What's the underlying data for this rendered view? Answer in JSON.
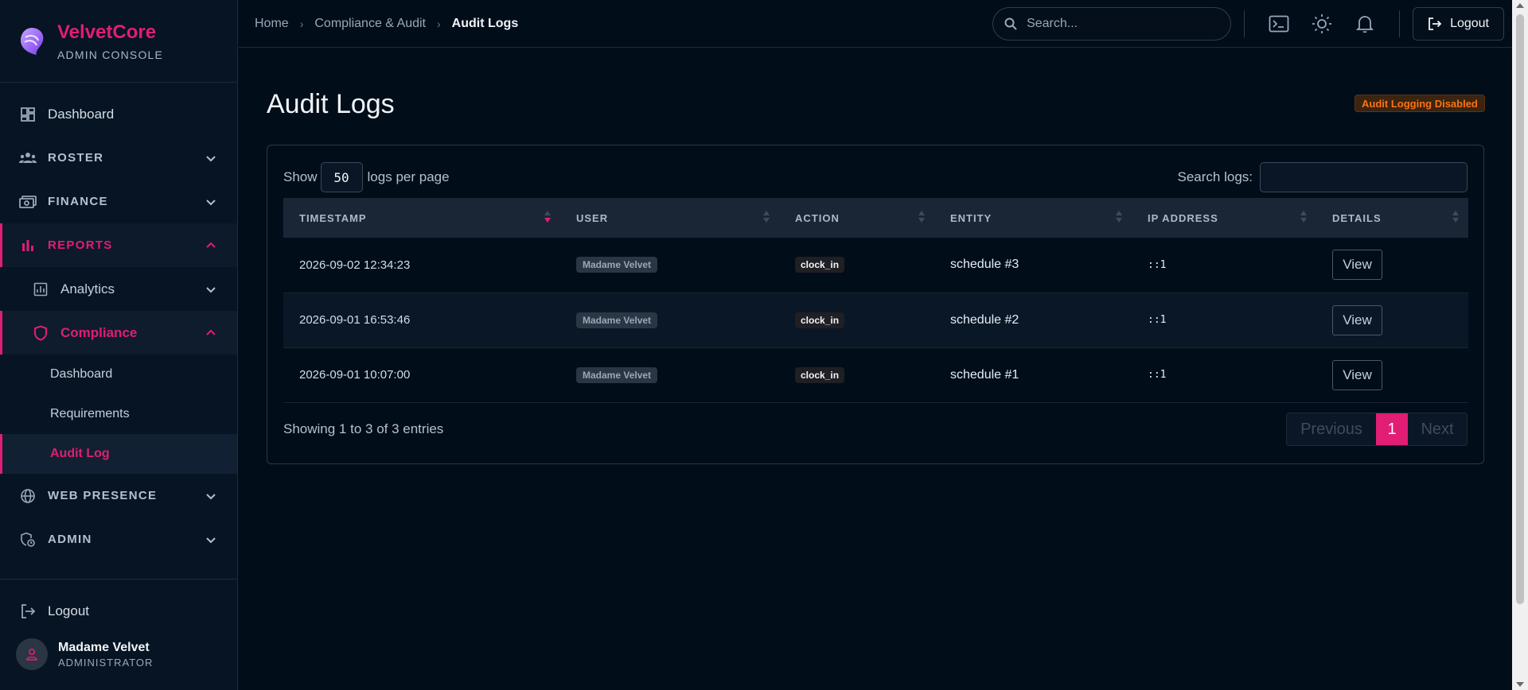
{
  "brand": {
    "name": "VelvetCore",
    "subtitle": "ADMIN CONSOLE"
  },
  "sidebar": {
    "items": [
      {
        "label": "Dashboard",
        "icon": "dashboard-icon"
      },
      {
        "label": "ROSTER",
        "icon": "users-icon"
      },
      {
        "label": "FINANCE",
        "icon": "money-icon"
      },
      {
        "label": "REPORTS",
        "icon": "bar-chart-icon"
      },
      {
        "label": "Analytics",
        "icon": "analytics-icon"
      },
      {
        "label": "Compliance",
        "icon": "shield-icon"
      },
      {
        "label": "WEB PRESENCE",
        "icon": "globe-icon"
      },
      {
        "label": "ADMIN",
        "icon": "admin-icon"
      }
    ],
    "compliance_children": [
      "Dashboard",
      "Requirements",
      "Audit Log"
    ],
    "logout_label": "Logout",
    "user": {
      "name": "Madame Velvet",
      "role": "ADMINISTRATOR"
    }
  },
  "topbar": {
    "breadcrumbs": [
      "Home",
      "Compliance & Audit",
      "Audit Logs"
    ],
    "search_placeholder": "Search...",
    "logout_label": "Logout"
  },
  "main": {
    "title": "Audit Logs",
    "status_badge": "Audit Logging Disabled",
    "show_label": "Show",
    "per_page": "50",
    "per_page_suffix": "logs per page",
    "search_label": "Search logs:",
    "columns": [
      "TIMESTAMP",
      "USER",
      "ACTION",
      "ENTITY",
      "IP ADDRESS",
      "DETAILS"
    ],
    "rows": [
      {
        "timestamp": "2026-09-02 12:34:23",
        "user": "Madame Velvet",
        "action": "clock_in",
        "entity": "schedule #3",
        "ip": "::1",
        "details": "View"
      },
      {
        "timestamp": "2026-09-01 16:53:46",
        "user": "Madame Velvet",
        "action": "clock_in",
        "entity": "schedule #2",
        "ip": "::1",
        "details": "View"
      },
      {
        "timestamp": "2026-09-01 10:07:00",
        "user": "Madame Velvet",
        "action": "clock_in",
        "entity": "schedule #1",
        "ip": "::1",
        "details": "View"
      }
    ],
    "showing": "Showing 1 to 3 of 3 entries",
    "pagination": {
      "previous": "Previous",
      "current": "1",
      "next": "Next"
    }
  },
  "colors": {
    "accent": "#e11d74",
    "background": "#020d1a",
    "warning": "#f97316"
  }
}
